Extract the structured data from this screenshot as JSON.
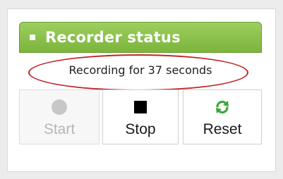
{
  "panel": {
    "title": "Recorder status",
    "status_text": "Recording for 37 seconds"
  },
  "buttons": {
    "start": {
      "label": "Start",
      "icon": "start-dot-icon",
      "enabled": false
    },
    "stop": {
      "label": "Stop",
      "icon": "stop-square-icon",
      "enabled": true
    },
    "reset": {
      "label": "Reset",
      "icon": "refresh-icon",
      "enabled": true
    }
  },
  "colors": {
    "header_green": "#8cc24d",
    "highlight_red": "#c0262c",
    "reset_icon_green": "#3aa63a",
    "disabled_gray": "#c7c7c7"
  }
}
